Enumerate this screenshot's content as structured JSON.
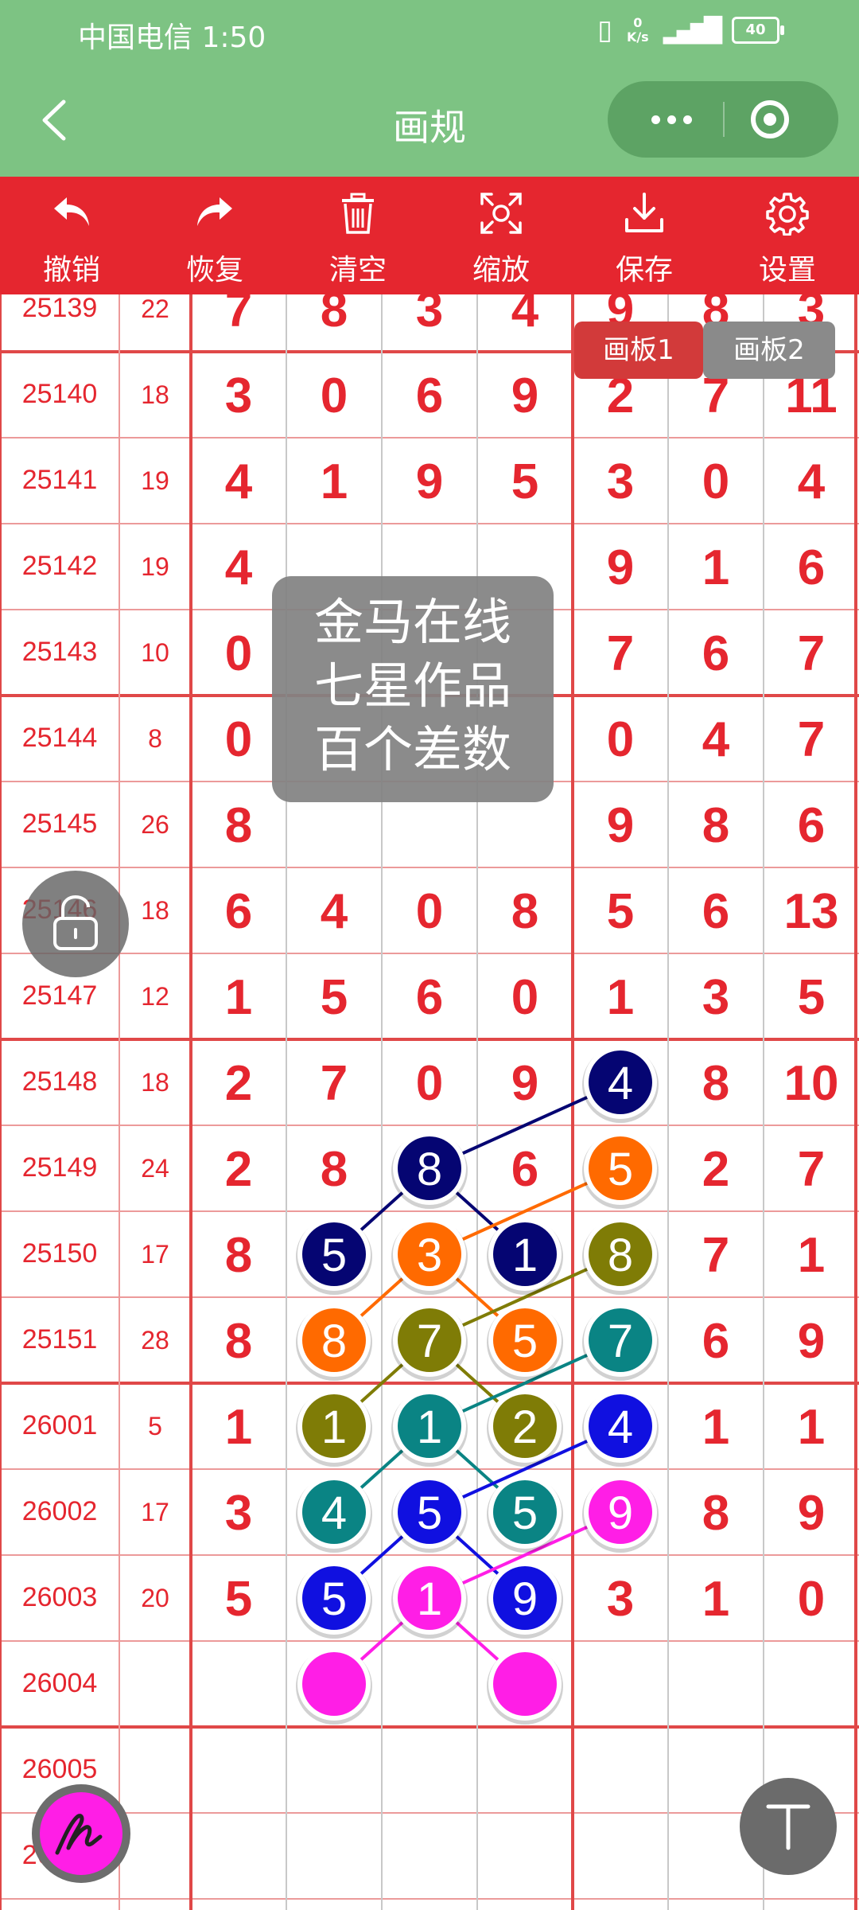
{
  "status_bar": {
    "carrier_time": "中国电信 1:50",
    "speed_value": "0",
    "speed_unit": "K/s",
    "battery": "40"
  },
  "nav": {
    "title": "画规"
  },
  "toolbar": {
    "items": [
      {
        "label": "撤销",
        "icon": "undo-icon"
      },
      {
        "label": "恢复",
        "icon": "redo-icon"
      },
      {
        "label": "清空",
        "icon": "trash-icon"
      },
      {
        "label": "缩放",
        "icon": "zoom-icon"
      },
      {
        "label": "保存",
        "icon": "download-icon"
      },
      {
        "label": "设置",
        "icon": "gear-icon"
      }
    ]
  },
  "boards": [
    "画板1",
    "画板2"
  ],
  "watermark": {
    "lines": [
      "金马在线",
      "七星作品",
      "百个差数"
    ]
  },
  "colors": {
    "red": "#e5262f",
    "header_green": "#7dc383",
    "navy": "#050572",
    "orange": "#ff6a00",
    "olive": "#7f7c06",
    "teal": "#0a8484",
    "blue": "#1010e0",
    "magenta": "#ff1ee6"
  },
  "grid": {
    "rows": [
      {
        "issue": "25139",
        "sum": "22",
        "digits": [
          "7",
          "8",
          "3",
          "4",
          "9",
          "8",
          "3"
        ]
      },
      {
        "issue": "25140",
        "sum": "18",
        "digits": [
          "3",
          "0",
          "6",
          "9",
          "2",
          "7",
          "11"
        ]
      },
      {
        "issue": "25141",
        "sum": "19",
        "digits": [
          "4",
          "1",
          "9",
          "5",
          "3",
          "0",
          "4"
        ]
      },
      {
        "issue": "25142",
        "sum": "19",
        "digits": [
          "4",
          "",
          "",
          "",
          "9",
          "1",
          "6"
        ]
      },
      {
        "issue": "25143",
        "sum": "10",
        "digits": [
          "0",
          "",
          "",
          "",
          "7",
          "6",
          "7"
        ]
      },
      {
        "issue": "25144",
        "sum": "8",
        "digits": [
          "0",
          "",
          "",
          "",
          "0",
          "4",
          "7"
        ]
      },
      {
        "issue": "25145",
        "sum": "26",
        "digits": [
          "8",
          "",
          "",
          "",
          "9",
          "8",
          "6"
        ]
      },
      {
        "issue": "25146",
        "sum": "18",
        "digits": [
          "6",
          "4",
          "0",
          "8",
          "5",
          "6",
          "13"
        ]
      },
      {
        "issue": "25147",
        "sum": "12",
        "digits": [
          "1",
          "5",
          "6",
          "0",
          "1",
          "3",
          "5"
        ]
      },
      {
        "issue": "25148",
        "sum": "18",
        "digits": [
          "2",
          "7",
          "0",
          "9",
          "",
          "8",
          "10"
        ]
      },
      {
        "issue": "25149",
        "sum": "24",
        "digits": [
          "2",
          "8",
          "",
          "6",
          "",
          "2",
          "7"
        ]
      },
      {
        "issue": "25150",
        "sum": "17",
        "digits": [
          "8",
          "",
          "",
          "",
          "",
          "7",
          "1"
        ]
      },
      {
        "issue": "25151",
        "sum": "28",
        "digits": [
          "8",
          "",
          "",
          "",
          "",
          "6",
          "9"
        ]
      },
      {
        "issue": "26001",
        "sum": "5",
        "digits": [
          "1",
          "",
          "",
          "",
          "",
          "1",
          "1"
        ]
      },
      {
        "issue": "26002",
        "sum": "17",
        "digits": [
          "3",
          "",
          "",
          "",
          "",
          "8",
          "9"
        ]
      },
      {
        "issue": "26003",
        "sum": "20",
        "digits": [
          "5",
          "",
          "",
          "",
          "3",
          "1",
          "0"
        ]
      },
      {
        "issue": "26004",
        "sum": "",
        "digits": [
          "",
          "",
          "",
          "",
          "",
          "",
          ""
        ]
      },
      {
        "issue": "26005",
        "sum": "",
        "digits": [
          "",
          "",
          "",
          "",
          "",
          "",
          ""
        ]
      },
      {
        "issue": "26006",
        "sum": "",
        "digits": [
          "",
          "",
          "",
          "",
          "",
          "",
          ""
        ]
      }
    ]
  },
  "markers": [
    {
      "row": 9,
      "col": 4,
      "label": "4",
      "color": "#050572"
    },
    {
      "row": 10,
      "col": 2,
      "label": "8",
      "color": "#050572"
    },
    {
      "row": 10,
      "col": 4,
      "label": "5",
      "color": "#ff6a00"
    },
    {
      "row": 11,
      "col": 1,
      "label": "5",
      "color": "#050572"
    },
    {
      "row": 11,
      "col": 2,
      "label": "3",
      "color": "#ff6a00"
    },
    {
      "row": 11,
      "col": 3,
      "label": "1",
      "color": "#050572"
    },
    {
      "row": 11,
      "col": 4,
      "label": "8",
      "color": "#7f7c06"
    },
    {
      "row": 12,
      "col": 1,
      "label": "8",
      "color": "#ff6a00"
    },
    {
      "row": 12,
      "col": 2,
      "label": "7",
      "color": "#7f7c06"
    },
    {
      "row": 12,
      "col": 3,
      "label": "5",
      "color": "#ff6a00"
    },
    {
      "row": 12,
      "col": 4,
      "label": "7",
      "color": "#0a8484"
    },
    {
      "row": 13,
      "col": 1,
      "label": "1",
      "color": "#7f7c06"
    },
    {
      "row": 13,
      "col": 2,
      "label": "1",
      "color": "#0a8484"
    },
    {
      "row": 13,
      "col": 3,
      "label": "2",
      "color": "#7f7c06"
    },
    {
      "row": 13,
      "col": 4,
      "label": "4",
      "color": "#1010e0"
    },
    {
      "row": 14,
      "col": 1,
      "label": "4",
      "color": "#0a8484"
    },
    {
      "row": 14,
      "col": 2,
      "label": "5",
      "color": "#1010e0"
    },
    {
      "row": 14,
      "col": 3,
      "label": "5",
      "color": "#0a8484"
    },
    {
      "row": 14,
      "col": 4,
      "label": "9",
      "color": "#ff1ee6"
    },
    {
      "row": 15,
      "col": 1,
      "label": "5",
      "color": "#1010e0"
    },
    {
      "row": 15,
      "col": 2,
      "label": "1",
      "color": "#ff1ee6"
    },
    {
      "row": 15,
      "col": 3,
      "label": "9",
      "color": "#1010e0"
    },
    {
      "row": 16,
      "col": 1,
      "label": "",
      "color": "#ff1ee6"
    },
    {
      "row": 16,
      "col": 3,
      "label": "",
      "color": "#ff1ee6"
    }
  ],
  "connectors": [
    {
      "color": "#050572",
      "path": [
        [
          9,
          4
        ],
        [
          10,
          2
        ],
        [
          11,
          1
        ]
      ]
    },
    {
      "color": "#050572",
      "path": [
        [
          10,
          2
        ],
        [
          11,
          3
        ]
      ]
    },
    {
      "color": "#ff6a00",
      "path": [
        [
          10,
          4
        ],
        [
          11,
          2
        ],
        [
          12,
          1
        ]
      ]
    },
    {
      "color": "#ff6a00",
      "path": [
        [
          11,
          2
        ],
        [
          12,
          3
        ]
      ]
    },
    {
      "color": "#7f7c06",
      "path": [
        [
          11,
          4
        ],
        [
          12,
          2
        ],
        [
          13,
          1
        ]
      ]
    },
    {
      "color": "#7f7c06",
      "path": [
        [
          12,
          2
        ],
        [
          13,
          3
        ]
      ]
    },
    {
      "color": "#0a8484",
      "path": [
        [
          12,
          4
        ],
        [
          13,
          2
        ],
        [
          14,
          1
        ]
      ]
    },
    {
      "color": "#0a8484",
      "path": [
        [
          13,
          2
        ],
        [
          14,
          3
        ]
      ]
    },
    {
      "color": "#1010e0",
      "path": [
        [
          13,
          4
        ],
        [
          14,
          2
        ],
        [
          15,
          1
        ]
      ]
    },
    {
      "color": "#1010e0",
      "path": [
        [
          14,
          2
        ],
        [
          15,
          3
        ]
      ]
    },
    {
      "color": "#ff1ee6",
      "path": [
        [
          14,
          4
        ],
        [
          15,
          2
        ],
        [
          16,
          1
        ]
      ]
    },
    {
      "color": "#ff1ee6",
      "path": [
        [
          15,
          2
        ],
        [
          16,
          3
        ]
      ]
    }
  ]
}
